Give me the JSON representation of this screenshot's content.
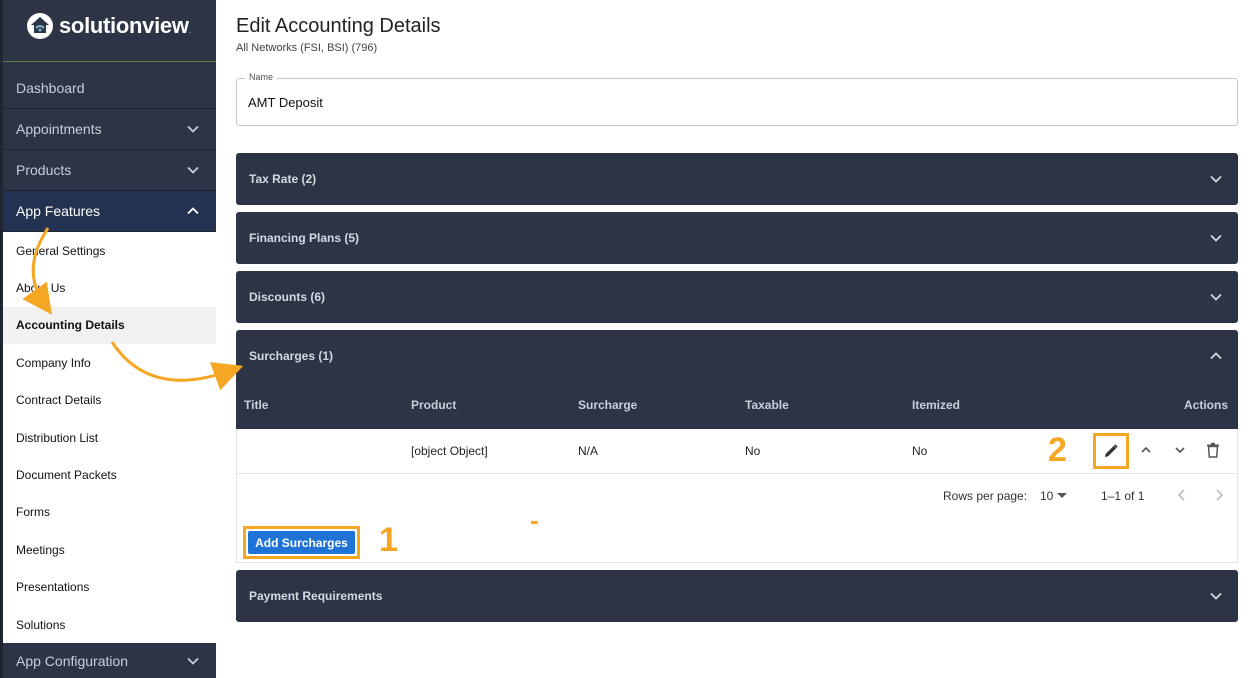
{
  "brand": {
    "name": "solutionview",
    "logo_icon": "house-wifi-icon"
  },
  "sidebar": {
    "items": [
      {
        "label": "Dashboard",
        "expandable": false
      },
      {
        "label": "Appointments",
        "expandable": true
      },
      {
        "label": "Products",
        "expandable": true
      },
      {
        "label": "App Features",
        "expandable": true,
        "active": true
      }
    ],
    "sub_items": [
      {
        "label": "General Settings"
      },
      {
        "label": "About Us"
      },
      {
        "label": "Accounting Details",
        "selected": true
      },
      {
        "label": "Company Info"
      },
      {
        "label": "Contract Details"
      },
      {
        "label": "Distribution List"
      },
      {
        "label": "Document Packets"
      },
      {
        "label": "Forms"
      },
      {
        "label": "Meetings"
      },
      {
        "label": "Presentations"
      },
      {
        "label": "Solutions"
      }
    ],
    "bottom_item": {
      "label": "App Configuration"
    }
  },
  "page": {
    "title": "Edit Accounting Details",
    "subtitle": "All Networks (FSI, BSI) (796)",
    "name_field": {
      "label": "Name",
      "value": "AMT Deposit"
    }
  },
  "panels": [
    {
      "label": "Tax Rate (2)",
      "expanded": false
    },
    {
      "label": "Financing Plans (5)",
      "expanded": false
    },
    {
      "label": "Discounts (6)",
      "expanded": false
    },
    {
      "label": "Surcharges (1)",
      "expanded": true
    },
    {
      "label": "Payment Requirements",
      "expanded": false
    }
  ],
  "surcharges_table": {
    "columns": [
      "Title",
      "Product",
      "Surcharge",
      "Taxable",
      "Itemized",
      "Actions"
    ],
    "rows": [
      {
        "title": "",
        "product": "[object Object]",
        "surcharge": "N/A",
        "taxable": "No",
        "itemized": "No"
      }
    ],
    "rows_per_page_label": "Rows per page:",
    "rows_per_page_value": "10",
    "range": "1–1 of 1",
    "add_button": "Add Surcharges"
  },
  "annotations": {
    "step1": "1",
    "step2": "2",
    "dash": "-",
    "color": "#f5a623"
  },
  "colors": {
    "sidebar": "#2c3446",
    "primary_button": "#1f73d6",
    "highlight": "#f5a623"
  }
}
